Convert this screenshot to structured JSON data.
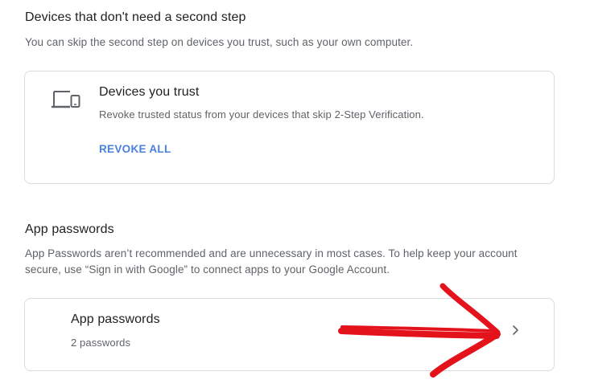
{
  "trusted_devices_section": {
    "title": "Devices that don't need a second step",
    "description": "You can skip the second step on devices you trust, such as your own computer.",
    "card": {
      "icon": "devices-icon",
      "title": "Devices you trust",
      "description": "Revoke trusted status from your devices that skip 2-Step Verification.",
      "action_label": "REVOKE ALL"
    }
  },
  "app_passwords_section": {
    "title": "App passwords",
    "description_line1": "App Passwords aren’t recommended and are unnecessary in most cases. To help keep your account",
    "description_line2": "secure, use “Sign in with Google” to connect apps to your Google Account.",
    "card": {
      "title": "App passwords",
      "subtitle": "2 passwords",
      "icon": "chevron-right-icon"
    }
  },
  "annotation": {
    "type": "hand-drawn red arrow",
    "color": "#e4121b"
  },
  "colors": {
    "link": "#4a80e0",
    "text_primary": "#202124",
    "text_secondary": "#5f6368",
    "border": "#dadce0"
  }
}
